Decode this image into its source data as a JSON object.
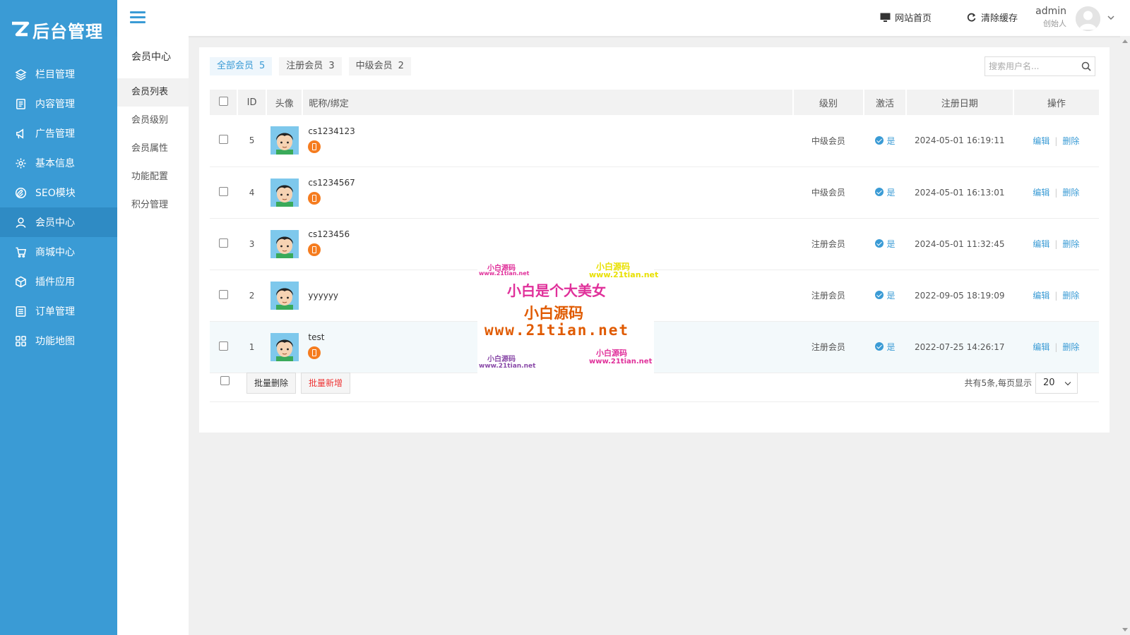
{
  "logo": {
    "text": "后台管理"
  },
  "sidebar": {
    "items": [
      {
        "label": "栏目管理",
        "icon": "layers-icon"
      },
      {
        "label": "内容管理",
        "icon": "document-icon"
      },
      {
        "label": "广告管理",
        "icon": "megaphone-icon"
      },
      {
        "label": "基本信息",
        "icon": "gear-icon"
      },
      {
        "label": "SEO模块",
        "icon": "paperclip-icon"
      },
      {
        "label": "会员中心",
        "icon": "user-icon",
        "active": true
      },
      {
        "label": "商城中心",
        "icon": "cart-icon"
      },
      {
        "label": "插件应用",
        "icon": "cube-icon"
      },
      {
        "label": "订单管理",
        "icon": "list-icon"
      },
      {
        "label": "功能地图",
        "icon": "grid-icon"
      }
    ]
  },
  "topbar": {
    "site_home": "网站首页",
    "clear_cache": "清除缓存",
    "user_name": "admin",
    "user_role": "创始人"
  },
  "subside": {
    "title": "会员中心",
    "items": [
      "会员列表",
      "会员级别",
      "会员属性",
      "功能配置",
      "积分管理"
    ]
  },
  "tabs": [
    {
      "label": "全部会员",
      "count": "5"
    },
    {
      "label": "注册会员",
      "count": "3"
    },
    {
      "label": "中级会员",
      "count": "2"
    }
  ],
  "search": {
    "placeholder": "搜索用户名..."
  },
  "table": {
    "headers": {
      "id": "ID",
      "avatar": "头像",
      "nick": "昵称/绑定",
      "level": "级别",
      "active": "激活",
      "date": "注册日期",
      "op": "操作"
    },
    "rows": [
      {
        "id": "5",
        "nick": "cs1234123",
        "bound": true,
        "level": "中级会员",
        "active": "是",
        "date": "2024-05-01 16:19:11"
      },
      {
        "id": "4",
        "nick": "cs1234567",
        "bound": true,
        "level": "中级会员",
        "active": "是",
        "date": "2024-05-01 16:13:01"
      },
      {
        "id": "3",
        "nick": "cs123456",
        "bound": true,
        "level": "注册会员",
        "active": "是",
        "date": "2024-05-01 11:32:45"
      },
      {
        "id": "2",
        "nick": "yyyyyy",
        "bound": false,
        "level": "注册会员",
        "active": "是",
        "date": "2022-09-05 18:19:09"
      },
      {
        "id": "1",
        "nick": "test",
        "bound": true,
        "level": "注册会员",
        "active": "是",
        "date": "2022-07-25 14:26:17"
      }
    ],
    "edit": "编辑",
    "delete": "删除"
  },
  "footer": {
    "batch_delete": "批量删除",
    "batch_add": "批量新增",
    "pager_text": "共有5条,每页显示",
    "page_size": "20"
  },
  "watermark": {
    "t1": "小白源码",
    "t2": "www.21tian.net",
    "t3": "小白源码",
    "t4": "www.21tian.net",
    "t5": "小白是个大美女",
    "t6": "小白源码",
    "t7": "www.21tian.net",
    "t8": "小白源码",
    "t9": "www.21tian.net",
    "t10": "小白源码",
    "t11": "www.21tian.net"
  },
  "colors": {
    "primary": "#3a9bd5",
    "sidebar_active": "#2f8bc4",
    "bind_orange": "#f57c1f",
    "danger": "#e33333"
  }
}
